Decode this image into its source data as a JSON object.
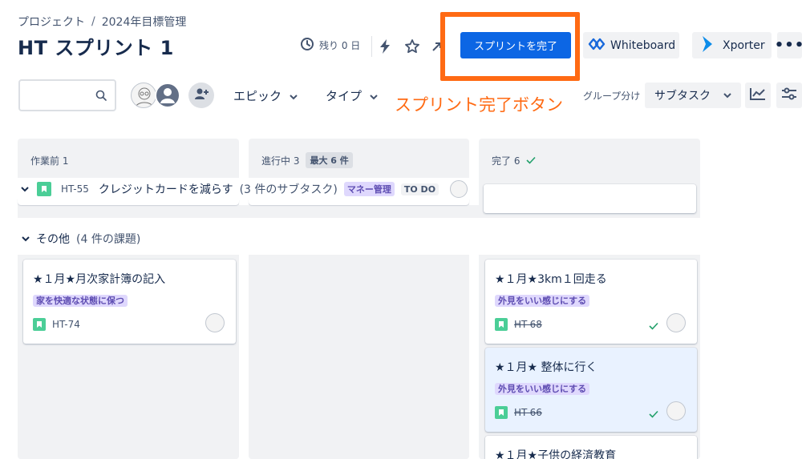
{
  "breadcrumb": {
    "project": "プロジェクト",
    "separator": "/",
    "board": "2024年目標管理"
  },
  "title": "HT スプリント 1",
  "header": {
    "time_remaining": "残り 0 日",
    "complete_sprint": "スプリントを完了",
    "whiteboard": "Whiteboard",
    "xporter": "Xporter",
    "more": "•••"
  },
  "toolbar": {
    "search_placeholder": "",
    "epic_filter": "エピック",
    "type_filter": "タイプ",
    "group_by_label": "グループ分け",
    "group_by_value": "サブタスク"
  },
  "annotation": "スプリント完了ボタン",
  "columns": [
    {
      "name": "作業前 1",
      "badge": ""
    },
    {
      "name": "進行中 3",
      "badge": "最大 6 件"
    },
    {
      "name": "完了 6",
      "badge": ""
    }
  ],
  "epic_row": {
    "key": "HT-55",
    "summary": "クレジットカードを減らす",
    "subtasks": "(3 件のサブタスク)",
    "epic": "マネー管理",
    "status": "TO DO"
  },
  "other_group": {
    "label": "その他",
    "count": "(4 件の課題)"
  },
  "cards": [
    {
      "title": "★１月★月次家計簿の記入",
      "epic": "家を快適な状態に保つ",
      "key": "HT-74"
    },
    {
      "title": "★１月★3km１回走る",
      "epic": "外見をいい感じにする",
      "key": "HT-68"
    },
    {
      "title": "★１月★ 整体に行く",
      "epic": "外見をいい感じにする",
      "key": "HT-66"
    },
    {
      "title": "★１月★子供の経済教育",
      "epic": "",
      "key": ""
    }
  ],
  "colors": {
    "accent": "#0c66e4",
    "annotation": "#ff6a13",
    "epic_green": "#4bce97"
  }
}
